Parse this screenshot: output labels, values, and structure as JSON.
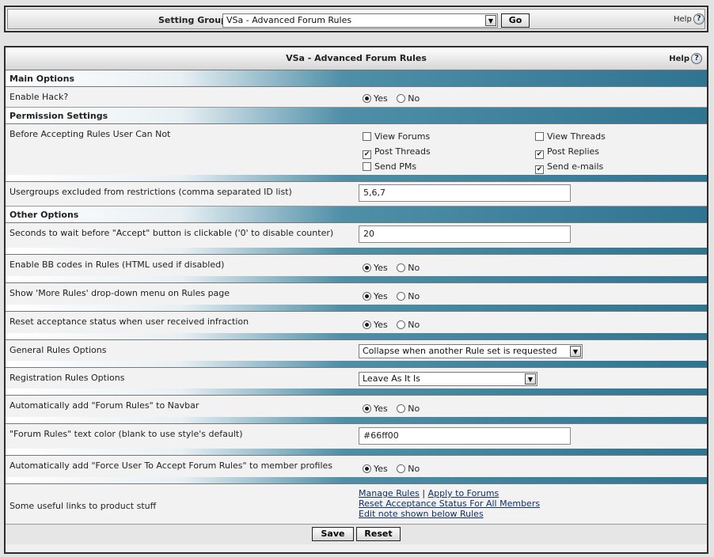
{
  "topbar": {
    "label": "Setting Group",
    "selected": "VSa - Advanced Forum Rules",
    "go": "Go",
    "help": "Help"
  },
  "panel": {
    "title": "VSa - Advanced Forum Rules",
    "help": "Help"
  },
  "sections": {
    "main": "Main Options",
    "permission": "Permission Settings",
    "other": "Other Options"
  },
  "radio": {
    "yes": "Yes",
    "no": "No"
  },
  "settings": {
    "enable_hack": {
      "label": "Enable Hack?",
      "value": "Yes"
    },
    "before_accepting": {
      "label": "Before Accepting Rules User Can Not",
      "options": [
        {
          "label": "View Forums",
          "checked": false
        },
        {
          "label": "View Threads",
          "checked": false
        },
        {
          "label": "Post Threads",
          "checked": true
        },
        {
          "label": "Post Replies",
          "checked": true
        },
        {
          "label": "Send PMs",
          "checked": false
        },
        {
          "label": "Send e-mails",
          "checked": true
        }
      ]
    },
    "usergroups": {
      "label": "Usergroups excluded from restrictions (comma separated ID list)",
      "value": "5,6,7"
    },
    "seconds": {
      "label": "Seconds to wait before \"Accept\" button is clickable ('0' to disable counter)",
      "value": "20"
    },
    "bbcodes": {
      "label": "Enable BB codes in Rules (HTML used if disabled)",
      "value": "Yes"
    },
    "more_rules": {
      "label": "Show 'More Rules' drop-down menu on Rules page",
      "value": "Yes"
    },
    "reset_infraction": {
      "label": "Reset acceptance status when user received infraction",
      "value": "Yes"
    },
    "general_rules": {
      "label": "General Rules Options",
      "value": "Collapse when another Rule set is requested"
    },
    "registration_rules": {
      "label": "Registration Rules Options",
      "value": "Leave As It Is"
    },
    "navbar": {
      "label": "Automatically add \"Forum Rules\" to Navbar",
      "value": "Yes"
    },
    "text_color": {
      "label": "\"Forum Rules\" text color (blank to use style's default)",
      "value": "#66ff00"
    },
    "force_accept": {
      "label": "Automatically add \"Force User To Accept Forum Rules\" to member profiles",
      "value": "Yes"
    },
    "links": {
      "label": "Some useful links to product stuff",
      "manage": "Manage Rules",
      "separator": "|",
      "apply": "Apply to Forums",
      "reset_all": "Reset Acceptance Status For All Members",
      "edit_note": "Edit note shown below Rules"
    }
  },
  "footer": {
    "save": "Save",
    "reset": "Reset"
  }
}
